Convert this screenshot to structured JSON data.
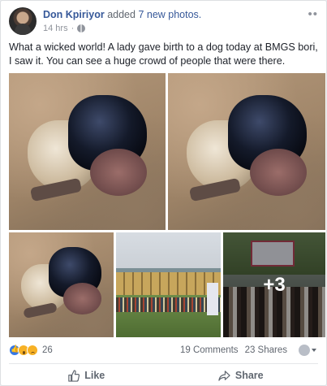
{
  "post": {
    "author": "Don Kpiriyor",
    "action": "added",
    "link_text": "7 new photos.",
    "time": "14 hrs",
    "menu_glyph": "••",
    "text": "What a wicked world! A lady gave birth to a dog today at BMGS bori, I saw it. You can see a huge crowd of people that were there."
  },
  "photos": {
    "items": [
      {
        "alt": "photo 1"
      },
      {
        "alt": "photo 2"
      },
      {
        "alt": "photo 3"
      },
      {
        "alt": "photo 4"
      },
      {
        "alt": "photo 5"
      }
    ],
    "more_label": "+3"
  },
  "stats": {
    "reaction_count": "26",
    "comments": "19 Comments",
    "shares": "23 Shares"
  },
  "actions": {
    "like": "Like",
    "share": "Share"
  },
  "colors": {
    "link": "#365899",
    "muted": "#616770",
    "like_blue": "#3578e5"
  }
}
